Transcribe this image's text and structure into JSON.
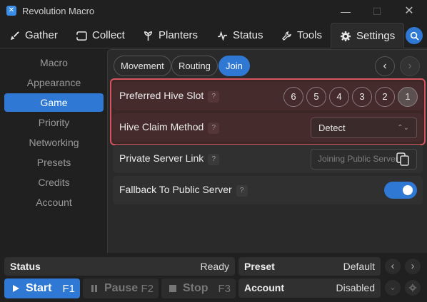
{
  "window": {
    "title": "Revolution Macro",
    "minimize": "—",
    "maximize": "☐",
    "close": "✕"
  },
  "tabs": [
    {
      "label": "Gather",
      "icon": "broom-icon"
    },
    {
      "label": "Collect",
      "icon": "ticket-icon"
    },
    {
      "label": "Planters",
      "icon": "sprout-icon"
    },
    {
      "label": "Status",
      "icon": "pulse-icon"
    },
    {
      "label": "Tools",
      "icon": "wrench-icon"
    },
    {
      "label": "Settings",
      "icon": "gear-icon",
      "active": true
    }
  ],
  "sidebar": {
    "items": [
      {
        "label": "Macro"
      },
      {
        "label": "Appearance"
      },
      {
        "label": "Game",
        "active": true
      },
      {
        "label": "Priority"
      },
      {
        "label": "Networking"
      },
      {
        "label": "Presets"
      },
      {
        "label": "Credits"
      },
      {
        "label": "Account"
      }
    ]
  },
  "subtabs": [
    {
      "label": "Movement"
    },
    {
      "label": "Routing"
    },
    {
      "label": "Join",
      "active": true
    }
  ],
  "subnav": {
    "prev": "‹",
    "next": "›"
  },
  "settings": {
    "hive_slot": {
      "label": "Preferred Hive Slot",
      "help": "?",
      "slots": [
        "6",
        "5",
        "4",
        "3",
        "2",
        "1"
      ],
      "selected": "1"
    },
    "hive_claim": {
      "label": "Hive Claim Method",
      "help": "?",
      "value": "Detect",
      "caret": "⌃⌄"
    },
    "private_server": {
      "label": "Private Server Link",
      "help": "?",
      "placeholder": "Joining Public Server"
    },
    "fallback": {
      "label": "Fallback To Public Server",
      "help": "?",
      "enabled": true
    }
  },
  "footer": {
    "status": {
      "label": "Status",
      "value": "Ready"
    },
    "preset": {
      "label": "Preset",
      "value": "Default"
    },
    "account": {
      "label": "Account",
      "value": "Disabled"
    },
    "start": {
      "label": "Start",
      "key": "F1"
    },
    "pause": {
      "label": "Pause",
      "key": "F2"
    },
    "stop": {
      "label": "Stop",
      "key": "F3"
    },
    "preset_prev": "‹",
    "preset_next": "›",
    "account_expand": "⌄"
  },
  "colors": {
    "accent": "#2f78d3",
    "highlight_border": "#d6555f"
  }
}
